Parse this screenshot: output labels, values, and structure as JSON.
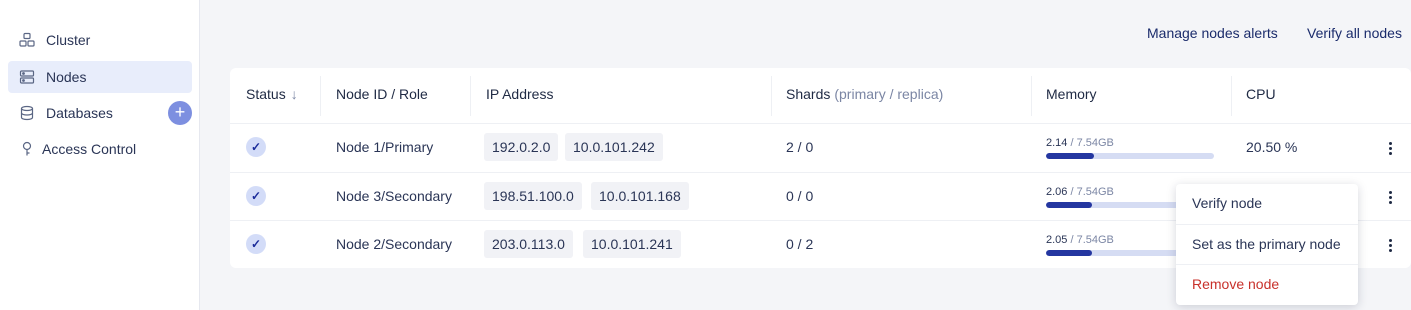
{
  "sidebar": {
    "items": [
      {
        "label": "Cluster",
        "icon": "cluster-icon"
      },
      {
        "label": "Nodes",
        "icon": "nodes-icon"
      },
      {
        "label": "Databases",
        "icon": "database-icon"
      },
      {
        "label": "Access Control",
        "icon": "key-icon"
      }
    ],
    "add_database": "+"
  },
  "toolbar": {
    "manage_alerts": "Manage nodes alerts",
    "verify_all": "Verify all nodes"
  },
  "table": {
    "headers": {
      "status": "Status",
      "sort_arrow": "↓",
      "node": "Node ID / Role",
      "ip": "IP Address",
      "shards": "Shards",
      "shards_sub": "(primary / replica)",
      "memory": "Memory",
      "cpu": "CPU"
    },
    "rows": [
      {
        "status": "✓",
        "node": "Node 1/Primary",
        "ip_external": "192.0.2.0",
        "ip_internal": "10.0.101.242",
        "shards": "2 / 0",
        "mem_used": "2.14",
        "mem_total": " / 7.54GB",
        "mem_fraction": 0.284,
        "cpu": "20.50 %"
      },
      {
        "status": "✓",
        "node": "Node 3/Secondary",
        "ip_external": "198.51.100.0",
        "ip_internal": "10.0.101.168",
        "shards": "0 / 0",
        "mem_used": "2.06",
        "mem_total": " / 7.54GB",
        "mem_fraction": 0.273,
        "cpu": ""
      },
      {
        "status": "✓",
        "node": "Node 2/Secondary",
        "ip_external": "203.0.113.0",
        "ip_internal": "10.0.101.241",
        "shards": "0 / 2",
        "mem_used": "2.05",
        "mem_total": " / 7.54GB",
        "mem_fraction": 0.272,
        "cpu": ""
      }
    ]
  },
  "context_menu": {
    "verify": "Verify node",
    "set_primary": "Set as the primary node",
    "remove": "Remove node"
  },
  "colors": {
    "accent": "#2436a0",
    "active_nav": "#e8edfb",
    "danger": "#c8312b"
  }
}
